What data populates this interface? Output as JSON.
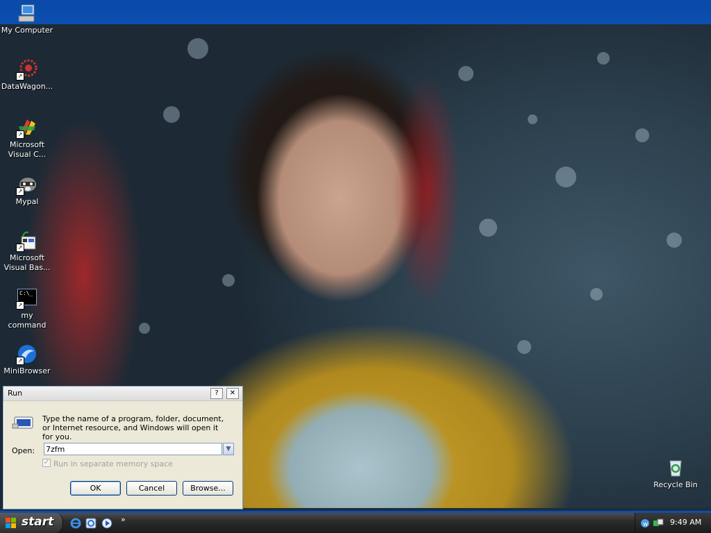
{
  "desktop": {
    "icons": [
      {
        "label": "My Computer"
      },
      {
        "label": "DataWagon..."
      },
      {
        "label_line1": "Microsoft",
        "label_line2": "Visual C..."
      },
      {
        "label": "Mypal"
      },
      {
        "label_line1": "Microsoft",
        "label_line2": "Visual Bas..."
      },
      {
        "label_line1": "my",
        "label_line2": "command"
      },
      {
        "label": "MiniBrowser"
      },
      {
        "label": "Recycle Bin"
      }
    ],
    "cmd_icon_text": "C:\\_"
  },
  "run_dialog": {
    "title": "Run",
    "help_button": "?",
    "close_button": "✕",
    "description": "Type the name of a program, folder, document, or Internet resource, and Windows will open it for you.",
    "open_label": "Open:",
    "open_value": "7zfm",
    "checkbox_label": "Run in separate memory space",
    "checkbox_mark": "✓",
    "ok_label": "OK",
    "cancel_label": "Cancel",
    "browse_label": "Browse..."
  },
  "taskbar": {
    "start_label": "start",
    "more_chevron": "»",
    "clock": "9:49 AM"
  },
  "colors": {
    "taskbar_accent": "#0b4fb0",
    "dialog_bg": "#ece9d8"
  }
}
